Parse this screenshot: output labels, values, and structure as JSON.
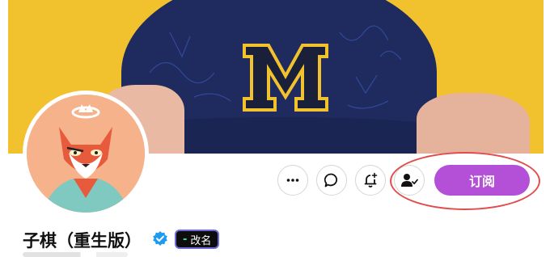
{
  "profile": {
    "display_name": "子棋（重生版）",
    "rename_label": "改名",
    "rename_marker": "-",
    "verified": true
  },
  "actions": {
    "subscribe_label": "订阅",
    "more_icon": "more-horizontal-icon",
    "comment_icon": "chat-bubble-icon",
    "notify_icon": "bell-plus-icon",
    "following_icon": "user-check-icon"
  },
  "banner": {
    "cap_letter": "M"
  },
  "colors": {
    "subscribe_bg": "#b44fd8",
    "highlight_ring": "#e24b4b",
    "banner_bg": "#f2c12e",
    "verified_badge": "#1d9bf0",
    "rename_border": "#6e6bd8"
  }
}
